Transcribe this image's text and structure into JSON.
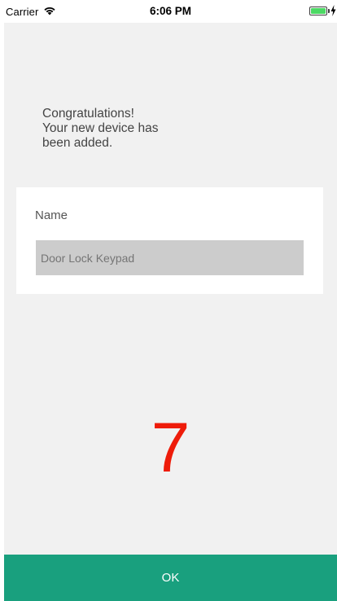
{
  "status_bar": {
    "carrier": "Carrier",
    "time": "6:06 PM",
    "wifi_icon": "wifi-icon",
    "battery_icon": "battery-icon",
    "charging_icon": "charging-bolt-icon"
  },
  "message": {
    "line1": "Congratulations!",
    "line2": "Your new device has",
    "line3": "been added."
  },
  "name_field": {
    "label": "Name",
    "placeholder": "Door Lock Keypad",
    "value": ""
  },
  "step_number": "7",
  "ok_button": {
    "label": "OK"
  },
  "colors": {
    "background": "#f1f1f1",
    "card": "#ffffff",
    "input_background": "#cccccc",
    "step_number": "#ee1c0a",
    "ok_button": "#19a07e",
    "battery": "#4cd964"
  }
}
